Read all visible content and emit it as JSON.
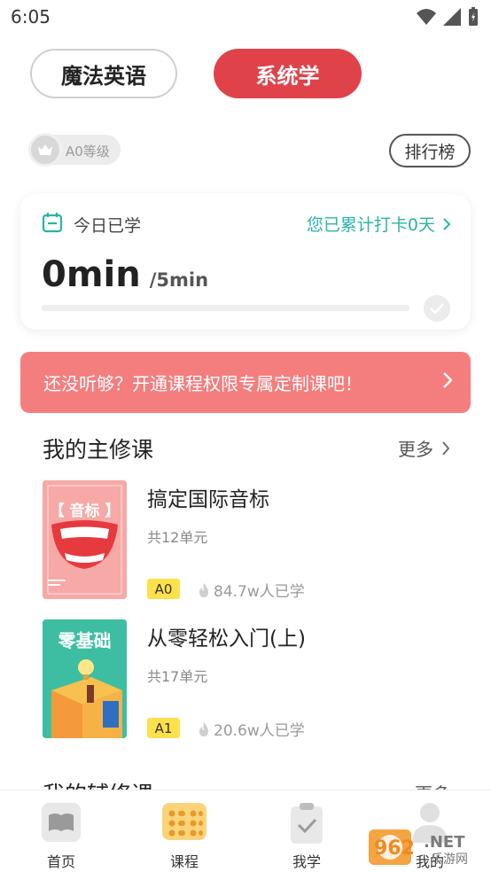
{
  "status": {
    "time": "6:05"
  },
  "top_tabs": {
    "left": "魔法英语",
    "right": "系统学"
  },
  "level_badge": {
    "text": "A0等级"
  },
  "rank_button": "排行榜",
  "study_card": {
    "label": "今日已学",
    "streak_text": "您已累计打卡0天",
    "minutes_done": "0min",
    "minutes_goal": "/5min",
    "progress": 0
  },
  "promo": {
    "text": "还没听够？开通课程权限专属定制课吧！"
  },
  "major_section": {
    "title": "我的主修课",
    "more": "更多"
  },
  "courses": [
    {
      "cover_text": "【 音标 】",
      "title": "搞定国际音标",
      "units": "共12单元",
      "level": "A0",
      "learners": "84.7w人已学"
    },
    {
      "cover_text": "零基础",
      "title": "从零轻松入门(上)",
      "units": "共17单元",
      "level": "A1",
      "learners": "20.6w人已学"
    }
  ],
  "minor_section": {
    "title": "我的辅修课",
    "more": "更多"
  },
  "nav": [
    {
      "label": "首页"
    },
    {
      "label": "课程"
    },
    {
      "label": "我学"
    },
    {
      "label": "我的"
    }
  ],
  "watermark": {
    "text": "962.NET",
    "sub": "乐游网"
  },
  "colors": {
    "accent_red": "#e0424a",
    "teal": "#2ab3a6",
    "promo": "#f47e7e",
    "level_yellow": "#fde14a"
  }
}
